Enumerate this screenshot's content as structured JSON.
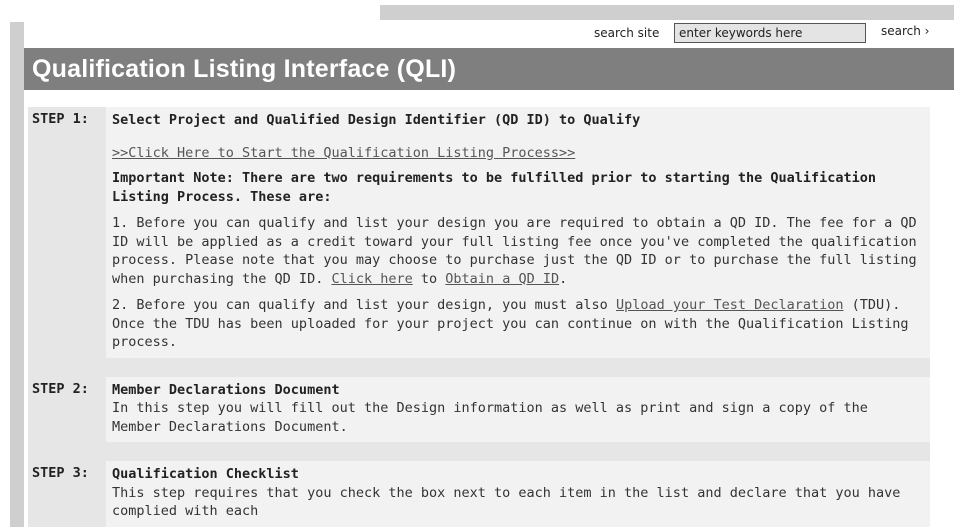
{
  "header": {
    "search_label": "search site",
    "search_value": "enter keywords here",
    "search_button": "search ›",
    "title": "Qualification Listing Interface (QLI)"
  },
  "steps": [
    {
      "label": "STEP 1:",
      "heading": "Select Project and Qualified Design Identifier (QD ID) to Qualify",
      "start_link": ">>Click Here to Start the Qualification Listing Process>>",
      "note": "Important Note: There are two requirements to be fulfilled prior to starting the Qualification Listing Process. These are:",
      "req1_text": "1. Before you can qualify and list your design you are required to obtain a QD ID. The fee for a QD ID will be applied as a credit toward your full listing fee once you've completed the qualification process. Please note that you may choose to purchase just the QD ID or to purchase the full listing when purchasing the QD ID.",
      "req1_link1": "Click here",
      "req1_to": "to",
      "req1_link2": "Obtain a QD ID",
      "req1_end": ".",
      "req2_text": "2. Before you can qualify and list your design, you must also",
      "req2_link": "Upload your Test Declaration",
      "req2_end": "(TDU). Once the TDU has been uploaded for your project you can continue on with the Qualification Listing process."
    },
    {
      "label": "STEP 2:",
      "heading": "Member Declarations Document",
      "text": "In this step you will fill out the Design information as well as print and sign a copy of the Member Declarations Document."
    },
    {
      "label": "STEP 3:",
      "heading": "Qualification Checklist",
      "text": "This step requires that you check the box next to each item in the list and declare that you have complied with each"
    }
  ]
}
